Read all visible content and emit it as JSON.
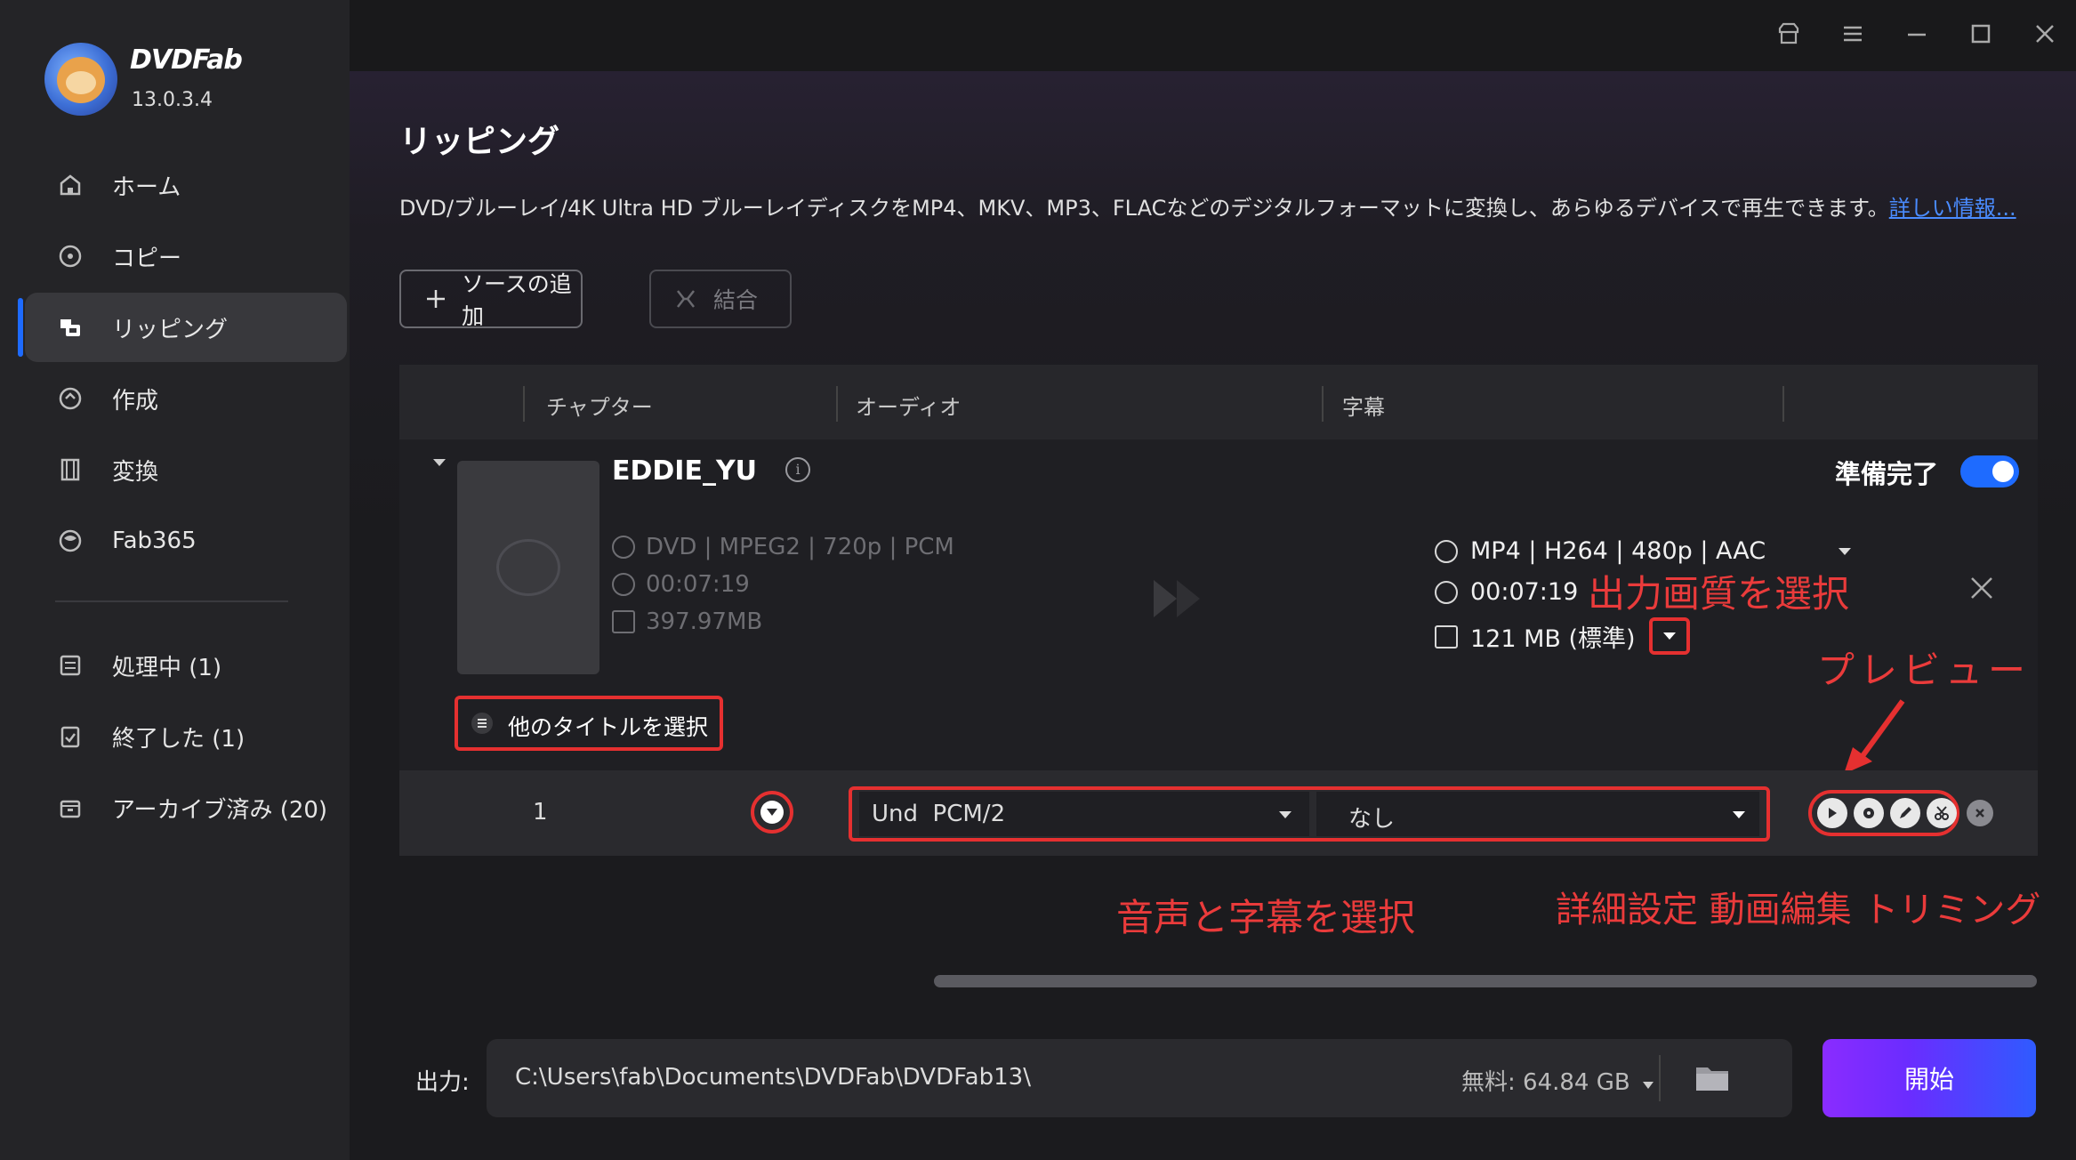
{
  "app": {
    "brand": "DVDFab",
    "version": "13.0.3.4"
  },
  "sidebar": {
    "items": [
      {
        "label": "ホーム",
        "icon": "home-icon"
      },
      {
        "label": "コピー",
        "icon": "copy-disc-icon"
      },
      {
        "label": "リッピング",
        "icon": "ripper-icon",
        "active": true
      },
      {
        "label": "作成",
        "icon": "create-disc-icon"
      },
      {
        "label": "変換",
        "icon": "film-icon"
      },
      {
        "label": "Fab365",
        "icon": "fab365-icon"
      }
    ],
    "queue": [
      {
        "label": "処理中 (1)",
        "icon": "processing-icon"
      },
      {
        "label": "終了した (1)",
        "icon": "finished-icon"
      },
      {
        "label": "アーカイブ済み (20)",
        "icon": "archive-icon"
      }
    ]
  },
  "page": {
    "title": "リッピング",
    "description": "DVD/ブルーレイ/4K Ultra HD ブルーレイディスクをMP4、MKV、MP3、FLACなどのデジタルフォーマットに変換し、あらゆるデバイスで再生できます。",
    "more_link": "詳しい情報..."
  },
  "toolbar": {
    "add_source": "ソースの追加",
    "merge": "結合"
  },
  "table": {
    "columns": [
      "チャプター",
      "オーディオ",
      "字幕"
    ]
  },
  "item": {
    "title": "EDDIE_YU",
    "source_format": "DVD | MPEG2 | 720p | PCM",
    "source_duration": "00:07:19",
    "source_size": "397.97MB",
    "output_format": "MP4 | H264 | 480p | AAC",
    "output_duration": "00:07:19",
    "output_size": "121 MB (標準)",
    "ready_label": "準備完了",
    "ready": true,
    "other_titles": "他のタイトルを選択"
  },
  "row": {
    "chapter": "1",
    "audio": "Und  PCM/2",
    "subtitle": "なし"
  },
  "annotations": {
    "output_quality": "出力画質を選択",
    "preview": "プレビュー",
    "audio_subtitle": "音声と字幕を選択",
    "tools": "詳細設定 動画編集 トリミング"
  },
  "footer": {
    "output_label": "出力:",
    "path": "C:\\Users\\fab\\Documents\\DVDFab\\DVDFab13\\",
    "free_space": "無料: 64.84 GB",
    "start": "開始"
  },
  "colors": {
    "accent": "#1e6bff",
    "annotation": "#e53030",
    "start_from": "#8a2cff",
    "start_to": "#2f5bff"
  }
}
